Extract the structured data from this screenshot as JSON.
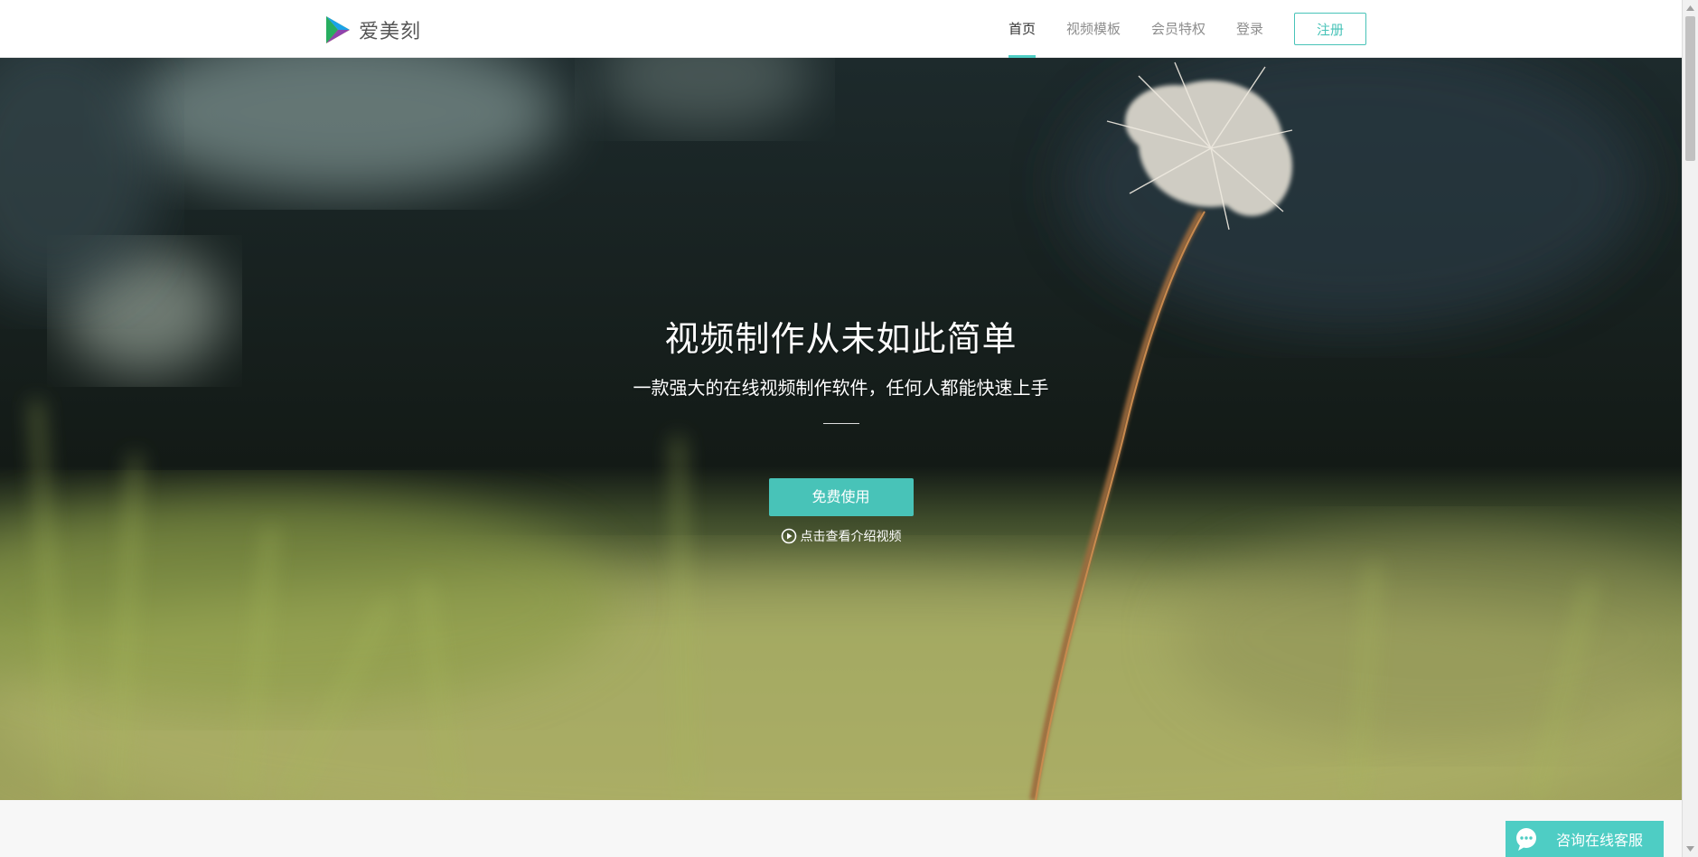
{
  "brand": {
    "name": "爱美刻",
    "logo_icon": "play-triangle-logo"
  },
  "nav": {
    "items": [
      {
        "label": "首页",
        "active": true
      },
      {
        "label": "视频模板",
        "active": false
      },
      {
        "label": "会员特权",
        "active": false
      },
      {
        "label": "登录",
        "active": false
      }
    ],
    "register_label": "注册"
  },
  "hero": {
    "title": "视频制作从未如此简单",
    "subtitle": "一款强大的在线视频制作软件，任何人都能快速上手",
    "cta_label": "免费使用",
    "intro_link_label": "点击查看介绍视频",
    "intro_icon": "play-circle-icon"
  },
  "chat": {
    "label": "咨询在线客服",
    "icon": "chat-bubble-icon"
  },
  "colors": {
    "accent": "#48c3b8",
    "accent_light": "#4ecdc4",
    "nav_text": "#8e8e8e",
    "nav_active": "#333333"
  }
}
